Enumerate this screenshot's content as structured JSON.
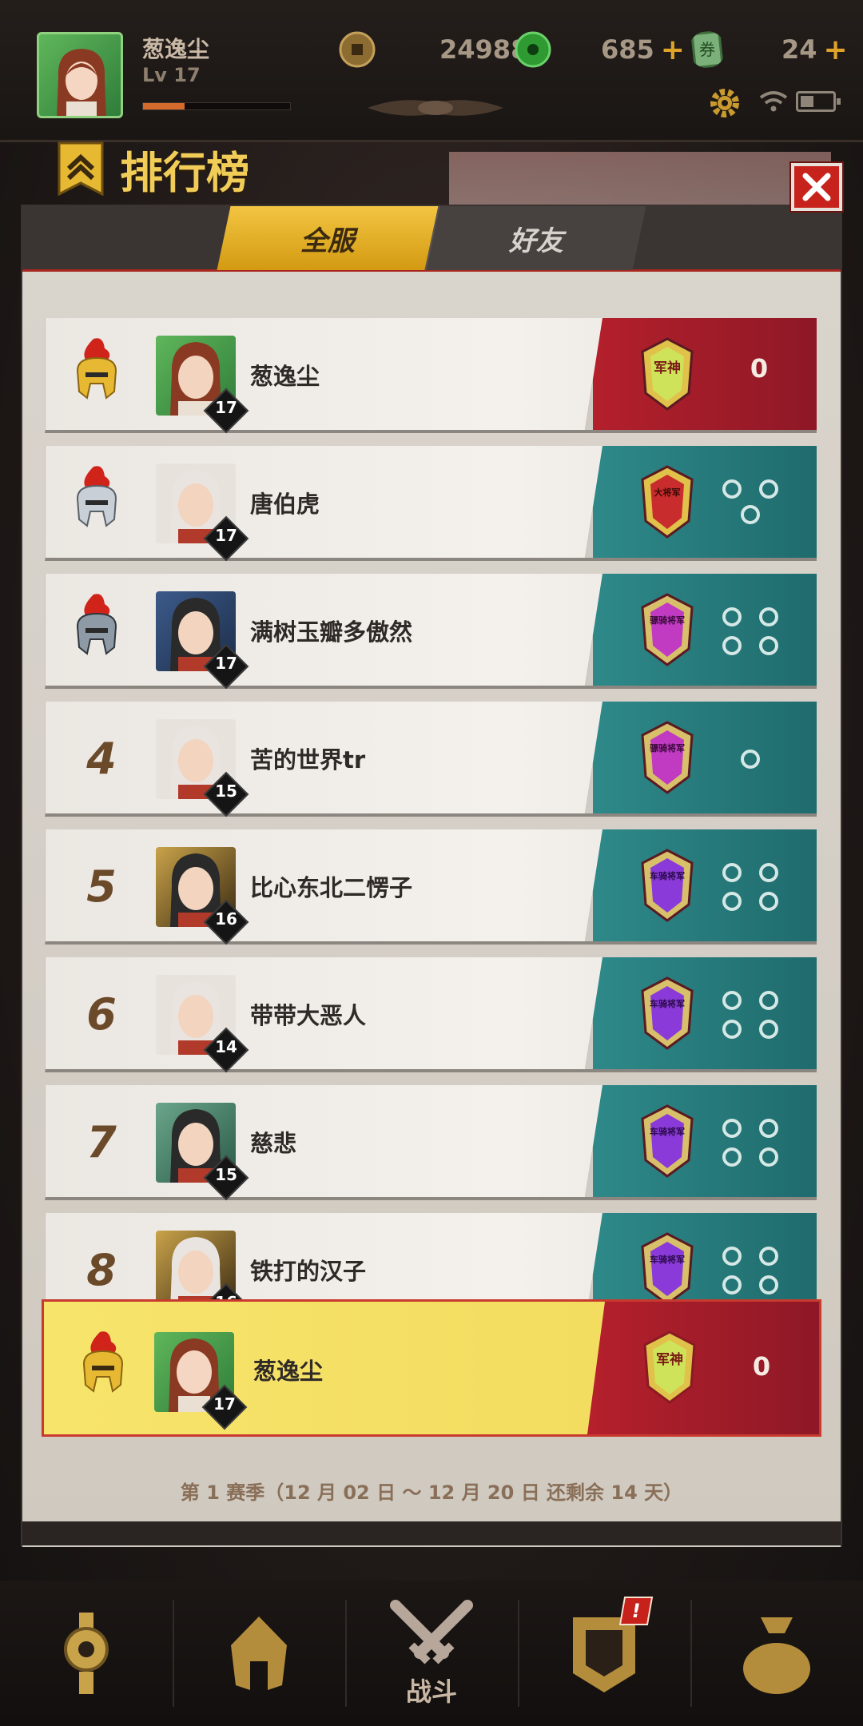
{
  "player": {
    "name": "葱逸尘",
    "level": "Lv 17",
    "xp_fraction": 0.28
  },
  "currencies": [
    {
      "icon": "copper-coin-icon",
      "value": "24988"
    },
    {
      "icon": "jade-coin-icon",
      "value": "685"
    },
    {
      "icon": "ticket-icon",
      "value": "24"
    }
  ],
  "plus_symbol": "+",
  "panel": {
    "title": "排行榜",
    "tabs": [
      "全服",
      "好友"
    ],
    "active_tab": 0
  },
  "rankings": [
    {
      "rank": "",
      "medal": "gold-helmet-icon",
      "name": "葱逸尘",
      "level": "17",
      "emblem": "军神",
      "stat_color": "red",
      "score": "0",
      "rings": 0
    },
    {
      "rank": "",
      "medal": "silver-helmet-icon",
      "name": "唐伯虎",
      "level": "17",
      "emblem": "大将军",
      "stat_color": "teal",
      "score": "",
      "rings": 3
    },
    {
      "rank": "",
      "medal": "bronze-helmet-icon",
      "name": "满树玉瓣多傲然",
      "level": "17",
      "emblem": "骠骑将军",
      "stat_color": "teal",
      "score": "",
      "rings": 4
    },
    {
      "rank": "4",
      "medal": "",
      "name": "苦的世界tr",
      "level": "15",
      "emblem": "骠骑将军",
      "stat_color": "teal",
      "score": "",
      "rings": 1
    },
    {
      "rank": "5",
      "medal": "",
      "name": "比心东北二愣子",
      "level": "16",
      "emblem": "车骑将军",
      "stat_color": "teal",
      "score": "",
      "rings": 4
    },
    {
      "rank": "6",
      "medal": "",
      "name": "带带大恶人",
      "level": "14",
      "emblem": "车骑将军",
      "stat_color": "teal",
      "score": "",
      "rings": 4
    },
    {
      "rank": "7",
      "medal": "",
      "name": "慈悲",
      "level": "15",
      "emblem": "车骑将军",
      "stat_color": "teal",
      "score": "",
      "rings": 4
    },
    {
      "rank": "8",
      "medal": "",
      "name": "铁打的汉子",
      "level": "16",
      "emblem": "车骑将军",
      "stat_color": "teal",
      "score": "",
      "rings": 4
    }
  ],
  "my_rank": {
    "name": "葱逸尘",
    "level": "17",
    "emblem": "军神",
    "score": "0"
  },
  "season_text": "第 1 赛季（12 月 02 日 ～ 12 月 20 日 还剩余 14 天）",
  "bottom_nav": [
    {
      "icon": "token-icon",
      "label": ""
    },
    {
      "icon": "helmet-icon",
      "label": ""
    },
    {
      "icon": "crossed-swords-icon",
      "label": "战斗"
    },
    {
      "icon": "shield-banner-icon",
      "label": "",
      "badge": "!"
    },
    {
      "icon": "money-bag-icon",
      "label": ""
    }
  ],
  "colors": {
    "accent_gold": "#f1cd58",
    "tab_active": "#e0ab22",
    "stat_red": "#a51c29",
    "stat_teal": "#2a7e80",
    "highlight_row": "#f5e06a"
  }
}
